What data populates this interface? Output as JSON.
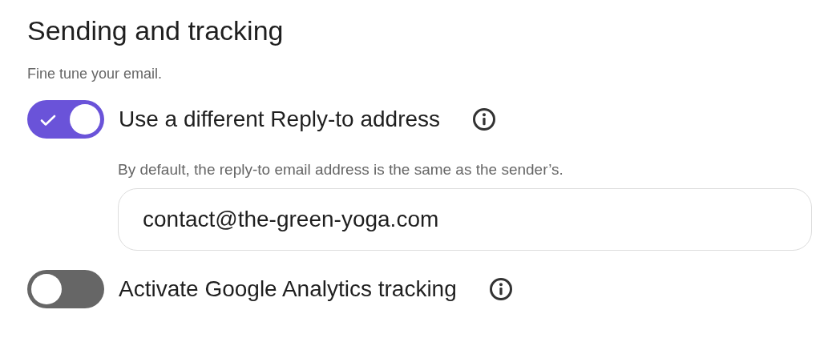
{
  "title": "Sending and tracking",
  "subtitle": "Fine tune your email.",
  "settings": [
    {
      "label": "Use a different Reply-to address",
      "on": true,
      "hint": "By default, the reply-to email address is the same as the sender’s.",
      "value": "contact@the-green-yoga.com"
    },
    {
      "label": "Activate Google Analytics tracking",
      "on": false
    }
  ]
}
